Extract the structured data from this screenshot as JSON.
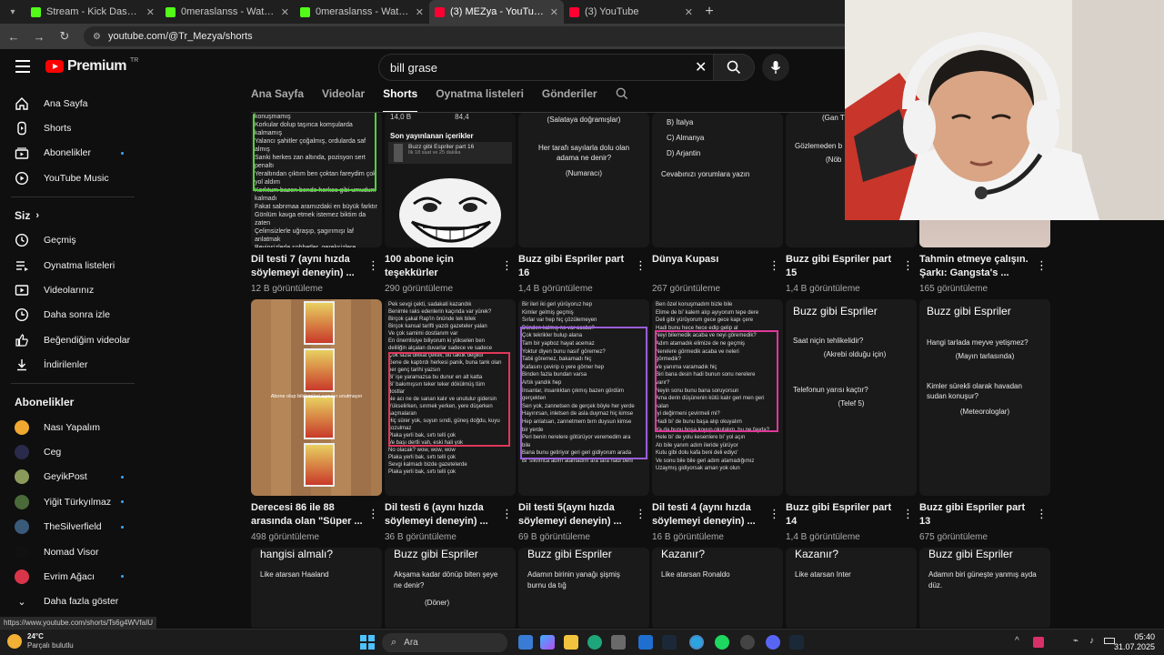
{
  "browser": {
    "tabs": [
      {
        "title": "Stream - Kick Dashboard",
        "color": "#53fc18",
        "active": false
      },
      {
        "title": "0meraslanss - Watch clips on K",
        "color": "#53fc18",
        "active": false
      },
      {
        "title": "0meraslanss - Watch clips on K",
        "color": "#53fc18",
        "active": false
      },
      {
        "title": "(3) MEZya - YouTube",
        "color": "#ff0033",
        "active": true
      },
      {
        "title": "(3) YouTube",
        "color": "#ff0033",
        "active": false
      }
    ],
    "url": "youtube.com/@Tr_Mezya/shorts"
  },
  "header": {
    "logo_text": "Premium",
    "logo_region": "TR",
    "search_value": "bill grase"
  },
  "sidebar": {
    "main": [
      {
        "label": "Ana Sayfa",
        "icon": "home-icon"
      },
      {
        "label": "Shorts",
        "icon": "shorts-icon"
      },
      {
        "label": "Abonelikler",
        "icon": "subscriptions-icon",
        "dot": true
      },
      {
        "label": "YouTube Music",
        "icon": "music-icon"
      }
    ],
    "you_title": "Siz",
    "you": [
      {
        "label": "Geçmiş",
        "icon": "history-icon"
      },
      {
        "label": "Oynatma listeleri",
        "icon": "playlists-icon"
      },
      {
        "label": "Videolarınız",
        "icon": "your-videos-icon"
      },
      {
        "label": "Daha sonra izle",
        "icon": "watch-later-icon"
      },
      {
        "label": "Beğendiğim videolar",
        "icon": "liked-icon"
      },
      {
        "label": "İndirilenler",
        "icon": "download-icon"
      }
    ],
    "subs_title": "Abonelikler",
    "subs": [
      {
        "label": "Nası Yapalım",
        "color": "#f0a830",
        "dot": false
      },
      {
        "label": "Ceg",
        "color": "#2a2a4a",
        "dot": false
      },
      {
        "label": "GeyikPost",
        "color": "#8a9a5a",
        "dot": true
      },
      {
        "label": "Yiğit Türkyılmaz",
        "color": "#4a6a3a",
        "dot": true
      },
      {
        "label": "TheSilverfield",
        "color": "#3a5a7a",
        "dot": true
      },
      {
        "label": "Nomad Visor",
        "color": "#111111",
        "dot": false
      },
      {
        "label": "Evrim Ağacı",
        "color": "#d9354a",
        "dot": true
      }
    ],
    "more_label": "Daha fazla göster"
  },
  "channel_tabs": {
    "items": [
      "Ana Sayfa",
      "Videolar",
      "Shorts",
      "Oynatma listeleri",
      "Gönderiler"
    ],
    "active": "Shorts"
  },
  "row1": [
    {
      "title": "Dil testi 7 (aynı hızda söylemeyi deneyin) ...",
      "views": "12 B görüntüleme"
    },
    {
      "title": "100 abone için teşekkürler",
      "views": "290 görüntüleme"
    },
    {
      "title": "Buzz gibi Espriler part 16",
      "views": "1,4 B görüntüleme"
    },
    {
      "title": "Dünya Kupası",
      "views": "267 görüntüleme"
    },
    {
      "title": "Buzz gibi Espriler part 15",
      "views": "1,4 B görüntüleme"
    },
    {
      "title": "Tahmin etmeye çalışın. Şarkı: Gangsta's ...",
      "views": "165 görüntüleme"
    }
  ],
  "row2": [
    {
      "title": "Derecesi 86 ile 88 arasında olan \"Süper ...",
      "views": "498 görüntüleme"
    },
    {
      "title": "Dil testi 6 (aynı hızda söylemeyi deneyin) ...",
      "views": "36 B görüntüleme"
    },
    {
      "title": "Dil testi 5(aynı hızda söylemeyi deneyin) ...",
      "views": "69 B görüntüleme"
    },
    {
      "title": "Dil testi 4 (aynı hızda söylemeyi deneyin) ...",
      "views": "16 B görüntüleme"
    },
    {
      "title": "Buzz gibi Espriler part 14",
      "views": "1,4 B görüntüleme"
    },
    {
      "title": "Buzz gibi Espriler part 13",
      "views": "675 görüntüleme"
    }
  ],
  "thumbs_r1": {
    "t1_lines": [
      "konuşmamış",
      "Korkular dolup taşınca komşularda kalmamış",
      "Yalancı şahitler çoğalmış, ordularda saf almış",
      "Sanki herkes zan altında, pozisyon sert penaltı",
      "Yeraltından çıktım ben çoktan fareydim çok",
      "yol aldım",
      "Korktum bazen bende herkes gibi umudum",
      "kalmadı",
      "Fakat sabrımaa aramızdaki en büyük farktır",
      "Gönlüm kavga etmek istemez biktim da zaten",
      "Çelimsizlerle uğraşıp, şagırımışı laf anlatmak",
      "Beyinsizlerle sohbetler, gereksizlere Öğütler",
      "Bakışlardan bellidir kim ne ister, niyetse nedir",
      "Orda kimse yok mu hadi biraz ses ver",
      "Burada ben sıkıldım yaklaş bana el ver",
      "Eninde sonunda görüşeceğiz elbet"
    ],
    "t2_stats": [
      "14,0 B",
      "84,4"
    ],
    "t2_recent": "Son yayınlanan içerikler",
    "t2_item": "Buzz gibi Espriler part 16",
    "t2_item_sub": "İlk 18 saat ve 25 dakika",
    "t3_lines": [
      "(Salataya doğramışlar)",
      "Her tarafı sayılarla dolu olan adama ne denir?",
      "(Numaracı)"
    ],
    "t4_lines": [
      "B) İtalya",
      "C) Almanya",
      "D) Arjantin",
      "Cevabınızı yorumlara yazın"
    ],
    "t5_lines": [
      "(Gan Türkçe v",
      "Gözlemeden b",
      "(Nöb"
    ]
  },
  "thumbs_r2": {
    "t1_text": "Abone olup bildirimleri açmayı unutmayın",
    "t2_lines": [
      "Pek sevgi çekti, sadakati kazandık",
      "Benimle raks edenlerin kaçında var yürek?",
      "Birçok çakal Rap'in önünde tek bilek",
      "Birçok kansal tarifti yazdı gazeteler yalan",
      "Ve çok samimi dostlanım var",
      "En önemlisiye biliyorum ki yükselen ben",
      "deliliğin alçalan duvarlar sadece ve sadece",
      "Çok fazla dikkat çektik, bu taktik değildi",
      "Gene de kaptırdı herkesi panik, buna tank olan",
      "her genç tarihi yazsın",
      "Bi' işe yaramazsa bu dunur en alt katta",
      "Bi' bakımışsın teker teker dökülmüş tüm",
      "dostlar",
      "Ne acı ne de sanan kalır ve unutulur gidersin",
      "Yükselirken, sınmek yerken, yere düşerken",
      "saçmalaran",
      "Hiç sürer yok, suyun sındi, güneş doğdu, kuyu",
      "kozulmaz",
      "Plaka yerli bak, sırtı telli çok",
      "Ve başı dertli vah, eski hali yok",
      "No olacak? wow, wow, wow",
      "Plaka yerli bak, sırtı telli çok",
      "Sevgi kalmadı bizde gazetelerde",
      "Plaka yerli bak, sırtı telli çok"
    ],
    "t3_lines": [
      "Bir ileri iki geri yürüyoruz hep",
      "Kimler gelmiş geçmiş",
      "Sırlar var hep hiç çözülemeyen",
      "Dünden kalmış ne var acaba?",
      "Çok tekrikler bulup alana",
      "Tam bir yapboz hayat acemaz",
      "Yoktur diyen bunu nasıl' göremez?",
      "Tabii göremez, bakamadı hiç",
      "Kafasını çevirip o yere görner hep",
      "Binden fazla bundan varsa",
      "Artık yandık hep",
      "İnsanlar, insanlıktan çıkmış bazen gördüm",
      "gerçekten",
      "Sen yok, zannetsen de gerçek böyle her yerde",
      "Hayırırsan, inletsen de asla duymaz hiç kimse",
      "Hep anlatsan, zannetmem bırn duysun kimse",
      "bir yerde",
      "Peri benin nerelere götürüyor veremedim ara",
      "bile",
      "Bana bunu getiriyor geri geri gidiyorum arada",
      "Bi' sıkılınca adım atamadım ara tara hadi beni"
    ],
    "t4_lines": [
      "Ben özel konuşmadım bizle bile",
      "Elime de bi' kalem alıp ayıyorum tepe dere",
      "Deli gibi yürüyorum gece gece kapı çere",
      "Hadi bunu hece hece edip gelip al",
      "Neyi bilemedik acaba ve neyi göremedik?",
      "Adım atamadık elimize de ne geçmiş",
      "Nerelere görmedik acaba ve neleri",
      "görmedik?",
      "Ve yanıma varamadık hiç",
      "Biri bana desin hadi bunun sonu nerelere",
      "varır?",
      "Neyin sonu bunu bana soruyorsun",
      "Ama derin düşünenin kütü kalır geri men geri",
      "kalan",
      "İyi değirmeni çevirmeli mi?",
      "Hadi bi' de bunu başa alıp okuyalım",
      "Ya da bunu boşa koyup okutalım, bu ne fayda?",
      "Hele bi' de yolu kesenlere bi' yol açın",
      "Atı bile yanım adım ileride yürüyor",
      "Kutu gibi dolu kafa beni deli ediyo'",
      "Ve sonu bile bile geri adım atamadığımız",
      "Uzaymış gidiyorsak aman yok olun"
    ],
    "t5_title": "Buzz gibi Espriler",
    "t5_lines": [
      "Saat niçin tehlikelidir?",
      "(Akrebi olduğu için)",
      "Telefonun yarısı kaçtır?",
      "(Telef 5)"
    ],
    "t6_title": "Buzz gibi Espriler",
    "t6_lines": [
      "Hangi tarlada meyve yetişmez?",
      "(Mayın tarlasında)",
      "Kimler sürekli olarak havadan sudan konuşur?",
      "(Meteorologlar)"
    ]
  },
  "row3": [
    {
      "heading": "hangisi almalı?",
      "line": "Like atarsan   Haaland"
    },
    {
      "heading": "Buzz gibi Espriler",
      "line": "Akşama kadar dönüp biten şeye ne denir?",
      "sub": "(Döner)"
    },
    {
      "heading": "Buzz gibi Espriler",
      "line": "Adamın birinin yanağı şişmiş burnu da tığ"
    },
    {
      "heading": "Kazanır?",
      "line": "Like atarsan   Ronaldo"
    },
    {
      "heading": "Kazanır?",
      "line": "Like atarsan   Inter"
    },
    {
      "heading": "Buzz gibi Espriler",
      "line": "Adamın biri güneşte yanmış ayda düz."
    }
  ],
  "status_url": "https://www.youtube.com/shorts/Ts6g4WVfaIU",
  "taskbar": {
    "temp": "24°C",
    "weather": "Parçalı bulutlu",
    "search": "Ara",
    "time": "05:40",
    "date": "31.07.2025"
  }
}
